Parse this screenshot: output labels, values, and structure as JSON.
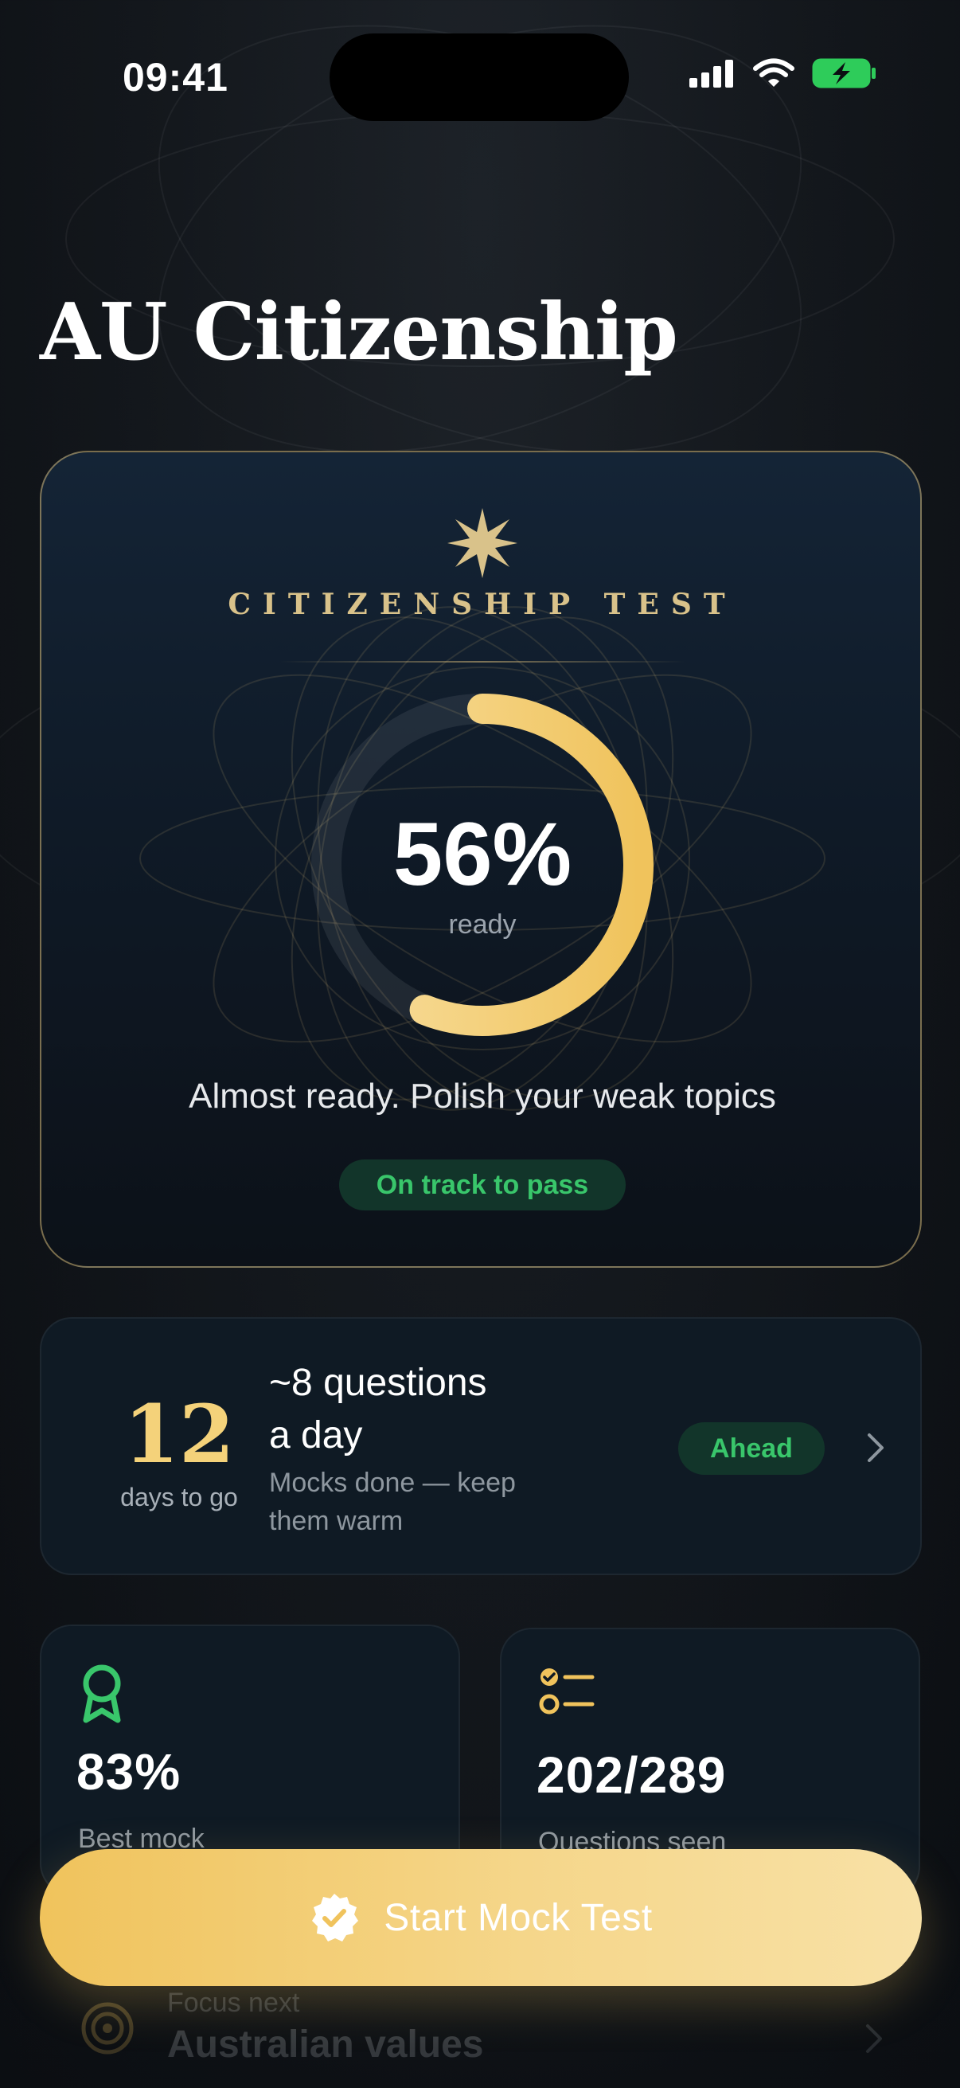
{
  "status_bar": {
    "time": "09:41",
    "icons": [
      "cellular-signal-icon",
      "wifi-icon",
      "battery-charging-icon"
    ]
  },
  "header": {
    "title": "AU Citizenship"
  },
  "readiness": {
    "eyebrow": "CITIZENSHIP TEST",
    "percent_text": "56%",
    "progress": 0.56,
    "caption": "ready",
    "message": "Almost ready. Polish your weak topics",
    "status_pill": "On track to pass"
  },
  "plan": {
    "days_value": "12",
    "days_label": "days to go",
    "title_line1": "~8 questions",
    "title_line2": "a day",
    "subtitle_line1": "Mocks done — keep",
    "subtitle_line2": "them warm",
    "badge": "Ahead"
  },
  "stats": [
    {
      "icon": "award-ribbon-icon",
      "value": "83%",
      "label": "Best mock"
    },
    {
      "icon": "checklist-icon",
      "value": "202/289",
      "label": "Questions seen"
    }
  ],
  "focus": {
    "kicker": "Focus next",
    "title": "Australian values",
    "icon": "target-icon"
  },
  "cta": {
    "label": "Start Mock Test",
    "icon": "verified-check-icon"
  },
  "colors": {
    "accent_gold": "#f4d27a",
    "success_green": "#39c66b",
    "background": "#14181d",
    "card": "#0f1a24"
  }
}
